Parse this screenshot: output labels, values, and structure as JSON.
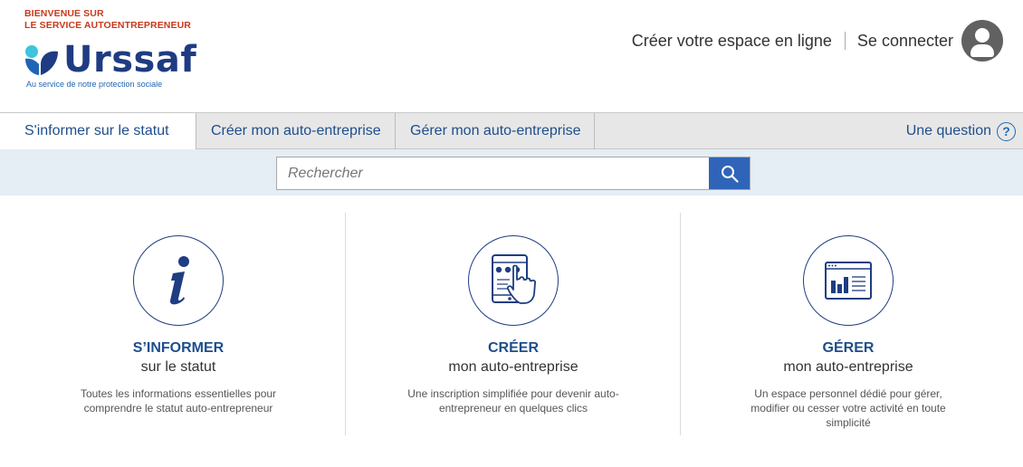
{
  "header": {
    "welcome_line1": "BIENVENUE SUR",
    "welcome_line2": "LE SERVICE AUTOENTREPRENEUR",
    "logo_text": "Urssaf",
    "tagline": "Au service de notre protection sociale",
    "create_space_label": "Créer votre espace en ligne",
    "login_label": "Se connecter",
    "avatar_icon": "user-icon"
  },
  "nav": {
    "items": [
      {
        "label": "S'informer sur le statut"
      },
      {
        "label": "Créer mon auto-entreprise"
      },
      {
        "label": "Gérer mon auto-entreprise"
      }
    ],
    "question_label": "Une question",
    "question_icon": "?"
  },
  "search": {
    "placeholder": "Rechercher",
    "button_icon": "search-icon"
  },
  "cards": [
    {
      "icon": "info-icon",
      "title": "S’INFORMER",
      "subtitle": "sur le statut",
      "desc": "Toutes les informations essentielles pour comprendre le statut auto-entrepreneur"
    },
    {
      "icon": "tablet-touch-icon",
      "title": "CRÉER",
      "subtitle": "mon auto-entreprise",
      "desc": "Une inscription simplifiée pour devenir auto-entrepreneur en quelques clics"
    },
    {
      "icon": "dashboard-chart-icon",
      "title": "GÉRER",
      "subtitle": "mon auto-entreprise",
      "desc": "Un espace personnel dédié pour gérer, modifier ou cesser votre activité en toute simplicité"
    }
  ],
  "colors": {
    "brand_blue": "#1f3b82",
    "link_blue": "#1f4e8c",
    "accent_orange": "#c9391c",
    "search_button": "#2f64b8",
    "nav_bg": "#e7e7e7",
    "search_band_bg": "#e5edf5"
  }
}
